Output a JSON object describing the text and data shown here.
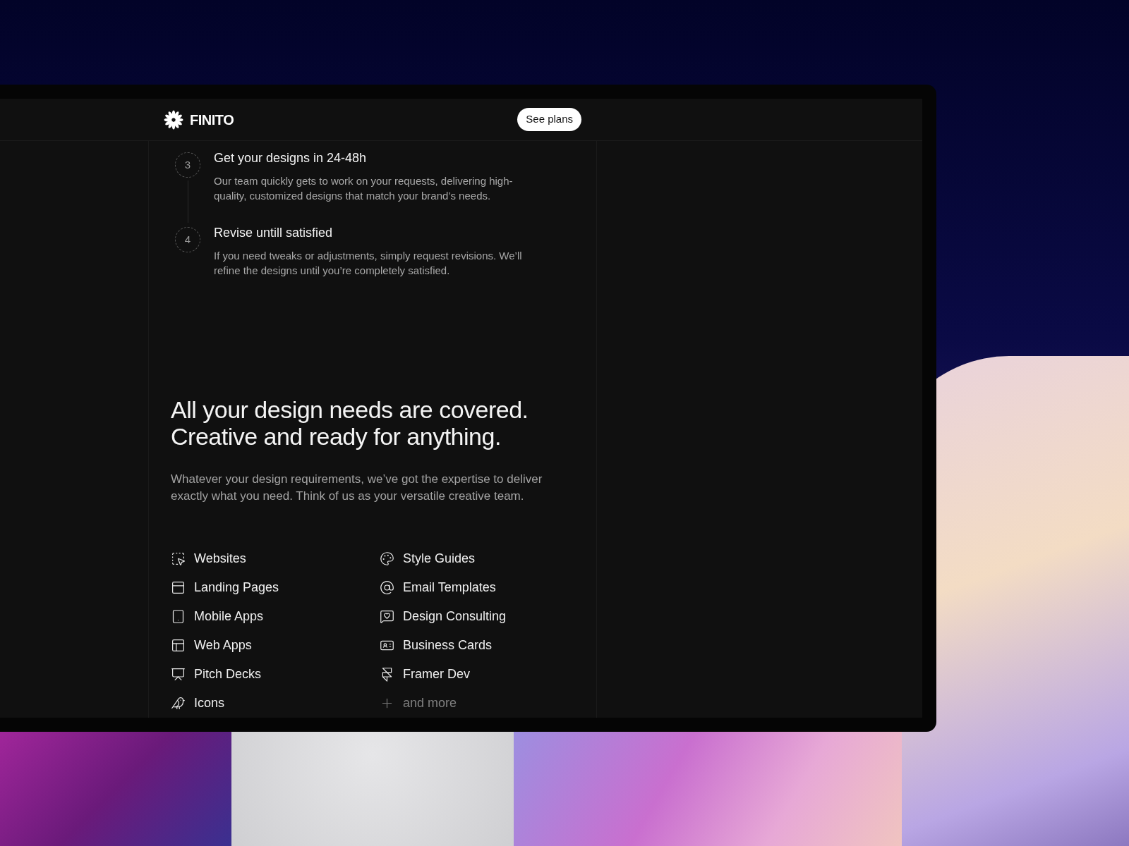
{
  "header": {
    "logo": "FINITO",
    "button": "See plans"
  },
  "steps": [
    {
      "number": "3",
      "title": "Get your designs in 24-48h",
      "text": "Our team quickly gets to work on your requests, delivering high-quality, customized designs that match your brand’s needs."
    },
    {
      "number": "4",
      "title": "Revise untill satisfied",
      "text": "If you need tweaks or adjustments, simply request revisions. We’ll refine the designs until you’re completely satisfied."
    }
  ],
  "section": {
    "heading_lines": [
      "All your design needs are covered.",
      "Creative and ready for anything."
    ],
    "text": "Whatever your design requirements, we’ve got the expertise to deliver exactly what you need. Think of us as your versatile creative team."
  },
  "services": [
    {
      "label": "Websites",
      "kind": "service"
    },
    {
      "label": "Landing Pages",
      "kind": "service"
    },
    {
      "label": "Mobile Apps",
      "kind": "service"
    },
    {
      "label": "Web Apps",
      "kind": "service"
    },
    {
      "label": "Pitch Decks",
      "kind": "service"
    },
    {
      "label": "Icons",
      "kind": "service"
    },
    {
      "label": "Style Guides",
      "kind": "service"
    },
    {
      "label": "Email Templates",
      "kind": "service"
    },
    {
      "label": "Design Consulting",
      "kind": "service"
    },
    {
      "label": "Business Cards",
      "kind": "service"
    },
    {
      "label": "Framer Dev",
      "kind": "service"
    },
    {
      "label": "and more",
      "kind": "more"
    }
  ]
}
